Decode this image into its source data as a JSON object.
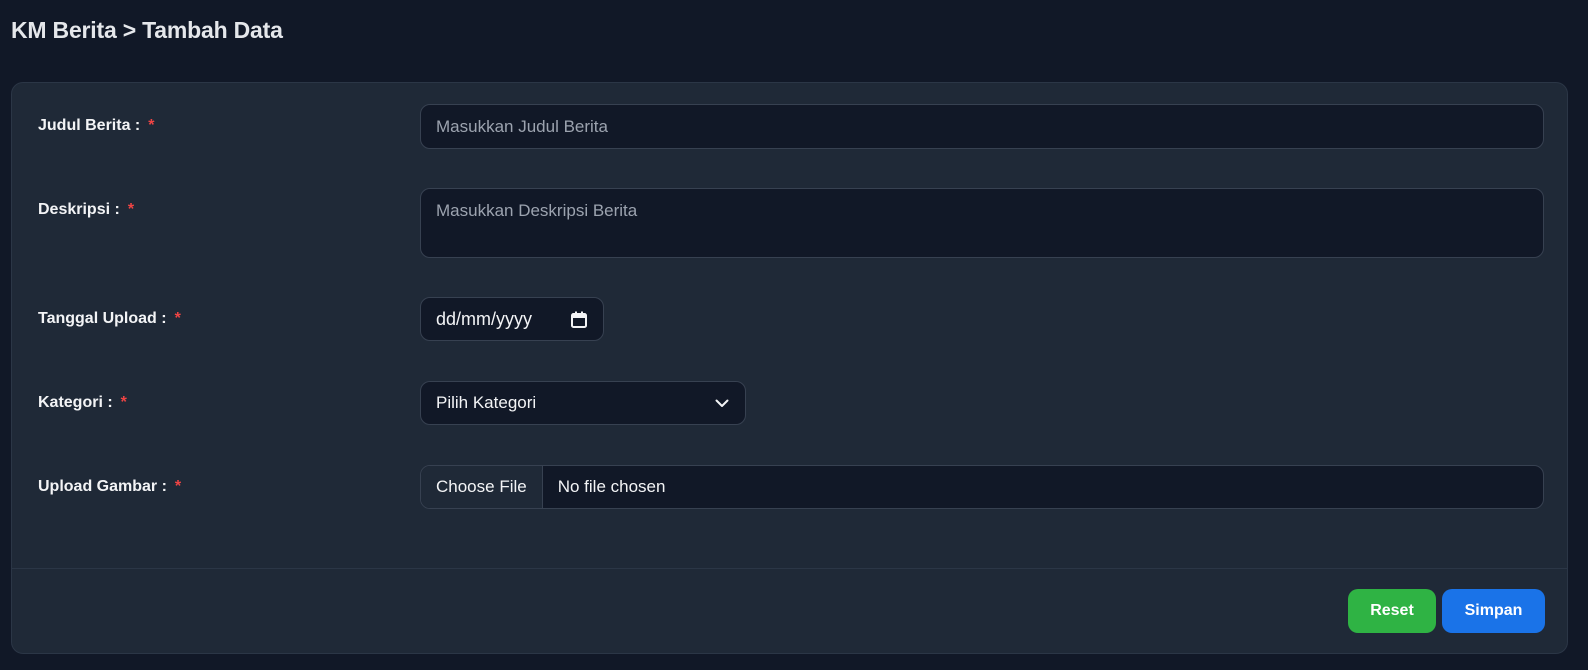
{
  "header": {
    "title": "KM Berita > Tambah Data"
  },
  "form": {
    "required_marker": "*",
    "judul": {
      "label": "Judul Berita :",
      "placeholder": "Masukkan Judul Berita",
      "value": ""
    },
    "deskripsi": {
      "label": "Deskripsi :",
      "placeholder": "Masukkan Deskripsi Berita",
      "value": ""
    },
    "tanggal": {
      "label": "Tanggal Upload :",
      "value": "dd/mm/yyyy",
      "icon": "calendar-icon"
    },
    "kategori": {
      "label": "Kategori :",
      "selected": "Pilih Kategori",
      "icon": "chevron-down-icon"
    },
    "gambar": {
      "label": "Upload Gambar :",
      "button_label": "Choose File",
      "file_name": "No file chosen"
    }
  },
  "actions": {
    "reset_label": "Reset",
    "save_label": "Simpan"
  },
  "colors": {
    "background": "#111827",
    "card": "#1f2937",
    "required": "#ef4444",
    "reset_button": "#2fb344",
    "save_button": "#1a73e8"
  }
}
